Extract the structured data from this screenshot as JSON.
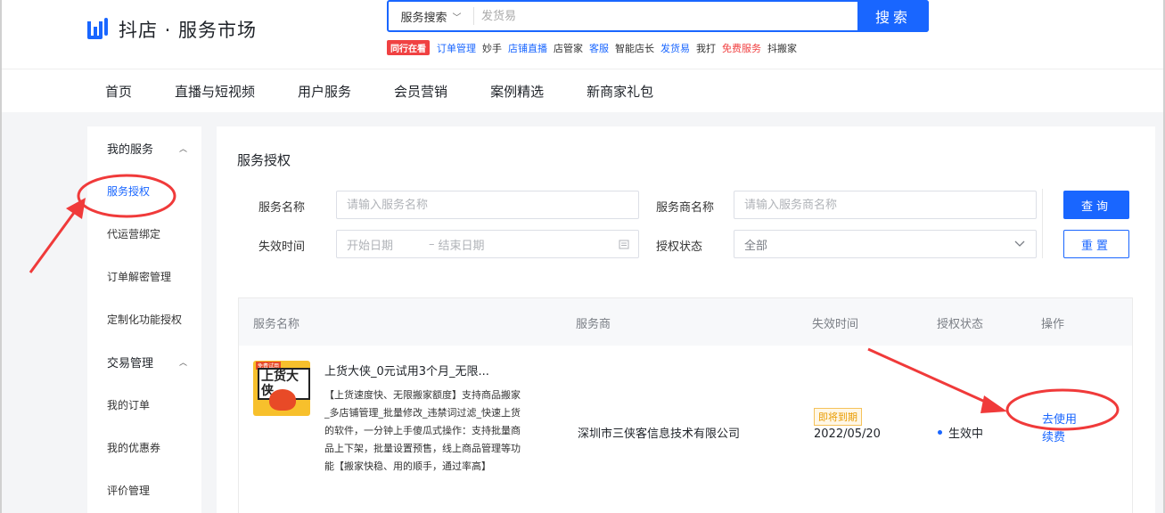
{
  "header": {
    "brand": "抖店 · 服务市场",
    "search": {
      "scope": "服务搜索",
      "placeholder": "发货易",
      "button": "搜索"
    },
    "hot_badge": "同行在看",
    "hot_links": [
      {
        "label": "订单管理",
        "color": "#1966ff"
      },
      {
        "label": "妙手",
        "color": "#333333"
      },
      {
        "label": "店铺直播",
        "color": "#1966ff"
      },
      {
        "label": "店管家",
        "color": "#333333"
      },
      {
        "label": "客服",
        "color": "#1966ff"
      },
      {
        "label": "智能店长",
        "color": "#333333"
      },
      {
        "label": "发货易",
        "color": "#1966ff"
      },
      {
        "label": "我打",
        "color": "#333333"
      },
      {
        "label": "免费服务",
        "color": "#f04142"
      },
      {
        "label": "抖搬家",
        "color": "#333333"
      }
    ]
  },
  "nav": [
    "首页",
    "直播与短视频",
    "用户服务",
    "会员营销",
    "案例精选",
    "新商家礼包"
  ],
  "sidebar": {
    "group1": "我的服务",
    "group1_items": [
      "服务授权",
      "代运营绑定",
      "订单解密管理",
      "定制化功能授权"
    ],
    "group2": "交易管理",
    "group2_items": [
      "我的订单",
      "我的优惠券",
      "评价管理"
    ]
  },
  "main": {
    "title": "服务授权",
    "filters": {
      "service_name_label": "服务名称",
      "service_name_placeholder": "请输入服务名称",
      "provider_label": "服务商名称",
      "provider_placeholder": "请输入服务商名称",
      "expire_label": "失效时间",
      "start_placeholder": "开始日期",
      "range_sep": "–",
      "end_placeholder": "结束日期",
      "status_label": "授权状态",
      "status_value": "全部",
      "query_button": "查询",
      "reset_button": "重置"
    },
    "table": {
      "columns": [
        "服务名称",
        "服务商",
        "失效时间",
        "授权状态",
        "操作"
      ],
      "row": {
        "thumb_text": "上货大侠",
        "thumb_badge": "免费试用",
        "name": "上货大侠_0元试用3个月_无限...",
        "desc": "【上货速度快、无限搬家额度】支持商品搬家_多店铺管理_批量修改_违禁词过滤_快速上货的软件，一分钟上手傻瓜式操作：支持批量商品上下架，批量设置预售，线上商品管理等功能【搬家快稳、用的顺手，通过率高】",
        "provider": "深圳市三侠客信息技术有限公司",
        "expire_tag": "即将到期",
        "expire_date": "2022/05/20",
        "status": "生效中",
        "op_use": "去使用",
        "op_renew": "续费"
      }
    }
  }
}
